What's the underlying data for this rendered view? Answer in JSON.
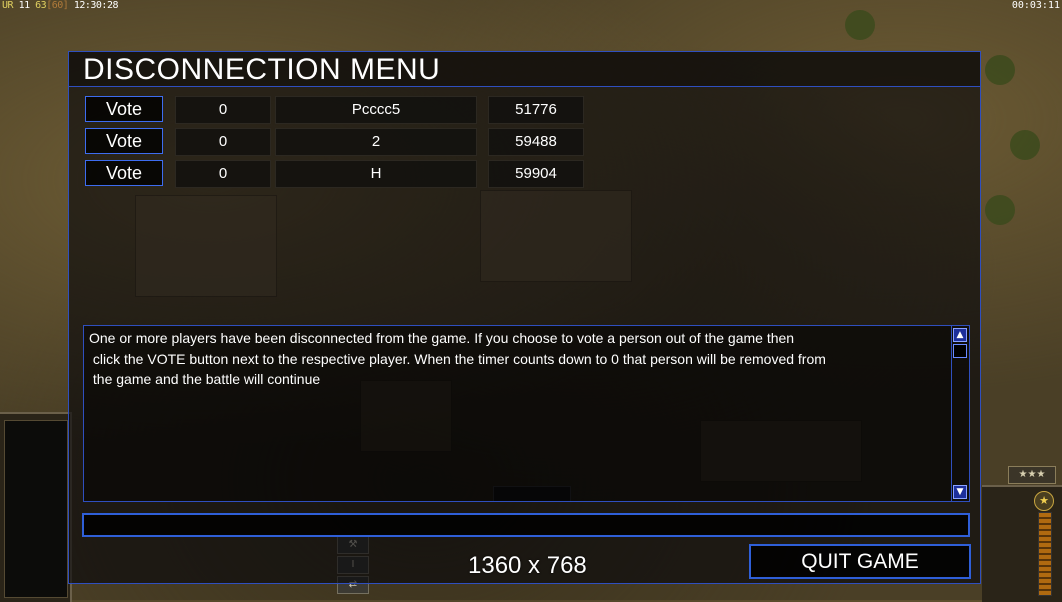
{
  "hud": {
    "top_left_prefix": "UR",
    "top_left_level": "11",
    "top_left_fps": "63",
    "top_left_cap": "[60]",
    "top_left_clock": "12:30:28",
    "top_right_clock": "00:03:11"
  },
  "dialog": {
    "title": "DISCONNECTION MENU",
    "players": [
      {
        "vote_label": "Vote",
        "timer": "0",
        "name": "Pcccc5",
        "ping": "51776"
      },
      {
        "vote_label": "Vote",
        "timer": "0",
        "name": "2",
        "ping": "59488"
      },
      {
        "vote_label": "Vote",
        "timer": "0",
        "name": "H",
        "ping": "59904"
      }
    ],
    "message": "One or more players have been disconnected from the game. If you choose to vote a person out of the game then\n click the VOTE button next to the respective player. When the timer counts down to 0 that person will be removed from\n the game and the battle will continue",
    "chat_value": "",
    "quit_label": "QUIT GAME"
  },
  "overlay": {
    "resolution_text": "1360 x 768"
  },
  "icons": {
    "scroll_up": "arrow-up-icon",
    "scroll_down": "arrow-down-icon",
    "rank": "rank-stars-icon",
    "general": "general-star-icon"
  },
  "colors": {
    "border_blue": "#2f4fbf",
    "button_blue": "#3d6cf0",
    "text": "#ffffff"
  }
}
